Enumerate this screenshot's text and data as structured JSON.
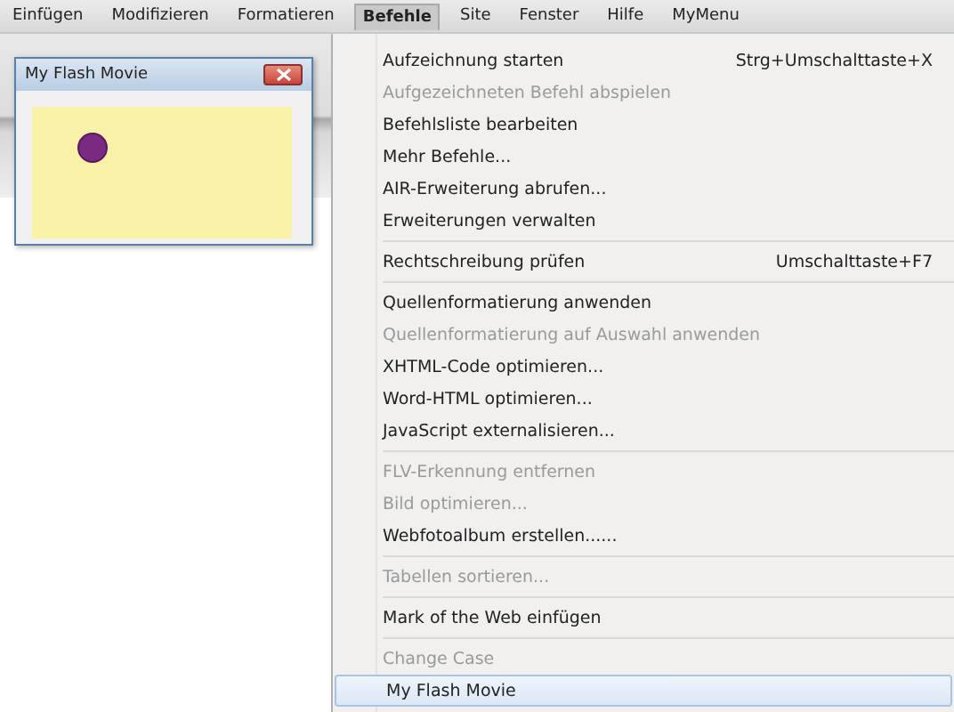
{
  "menu_bar": [
    {
      "label": "Einfügen",
      "selected": false
    },
    {
      "label": "Modifizieren",
      "selected": false
    },
    {
      "label": "Formatieren",
      "selected": false
    },
    {
      "label": "Befehle",
      "selected": true
    },
    {
      "label": "Site",
      "selected": false
    },
    {
      "label": "Fenster",
      "selected": false
    },
    {
      "label": "Hilfe",
      "selected": false
    },
    {
      "label": "MyMenu",
      "selected": false
    }
  ],
  "flash_window": {
    "title": "My Flash Movie"
  },
  "menu": [
    {
      "kind": "item",
      "label": "Aufzeichnung starten",
      "shortcut": "Strg+Umschalttaste+X",
      "disabled": false,
      "selected": false
    },
    {
      "kind": "item",
      "label": "Aufgezeichneten Befehl abspielen",
      "disabled": true,
      "selected": false
    },
    {
      "kind": "item",
      "label": "Befehlsliste bearbeiten",
      "disabled": false,
      "selected": false
    },
    {
      "kind": "item",
      "label": "Mehr Befehle...",
      "disabled": false,
      "selected": false
    },
    {
      "kind": "item",
      "label": "AIR-Erweiterung abrufen...",
      "disabled": false,
      "selected": false
    },
    {
      "kind": "item",
      "label": "Erweiterungen verwalten",
      "disabled": false,
      "selected": false
    },
    {
      "kind": "separator"
    },
    {
      "kind": "item",
      "label": "Rechtschreibung prüfen",
      "shortcut": "Umschalttaste+F7",
      "disabled": false,
      "selected": false
    },
    {
      "kind": "separator"
    },
    {
      "kind": "item",
      "label": "Quellenformatierung anwenden",
      "disabled": false,
      "selected": false
    },
    {
      "kind": "item",
      "label": "Quellenformatierung auf Auswahl anwenden",
      "disabled": true,
      "selected": false
    },
    {
      "kind": "item",
      "label": "XHTML-Code optimieren...",
      "disabled": false,
      "selected": false
    },
    {
      "kind": "item",
      "label": "Word-HTML optimieren...",
      "disabled": false,
      "selected": false
    },
    {
      "kind": "item",
      "label": "JavaScript externalisieren...",
      "disabled": false,
      "selected": false
    },
    {
      "kind": "separator"
    },
    {
      "kind": "item",
      "label": "FLV-Erkennung entfernen",
      "disabled": true,
      "selected": false
    },
    {
      "kind": "item",
      "label": "Bild optimieren...",
      "disabled": true,
      "selected": false
    },
    {
      "kind": "item",
      "label": "Webfotoalbum erstellen......",
      "disabled": false,
      "selected": false
    },
    {
      "kind": "separator"
    },
    {
      "kind": "item",
      "label": "Tabellen sortieren...",
      "disabled": true,
      "selected": false
    },
    {
      "kind": "separator"
    },
    {
      "kind": "item",
      "label": "Mark of the Web einfügen",
      "disabled": false,
      "selected": false
    },
    {
      "kind": "separator"
    },
    {
      "kind": "item",
      "label": "Change Case",
      "disabled": true,
      "selected": false
    },
    {
      "kind": "item",
      "label": "My Flash Movie",
      "disabled": false,
      "selected": true
    }
  ]
}
